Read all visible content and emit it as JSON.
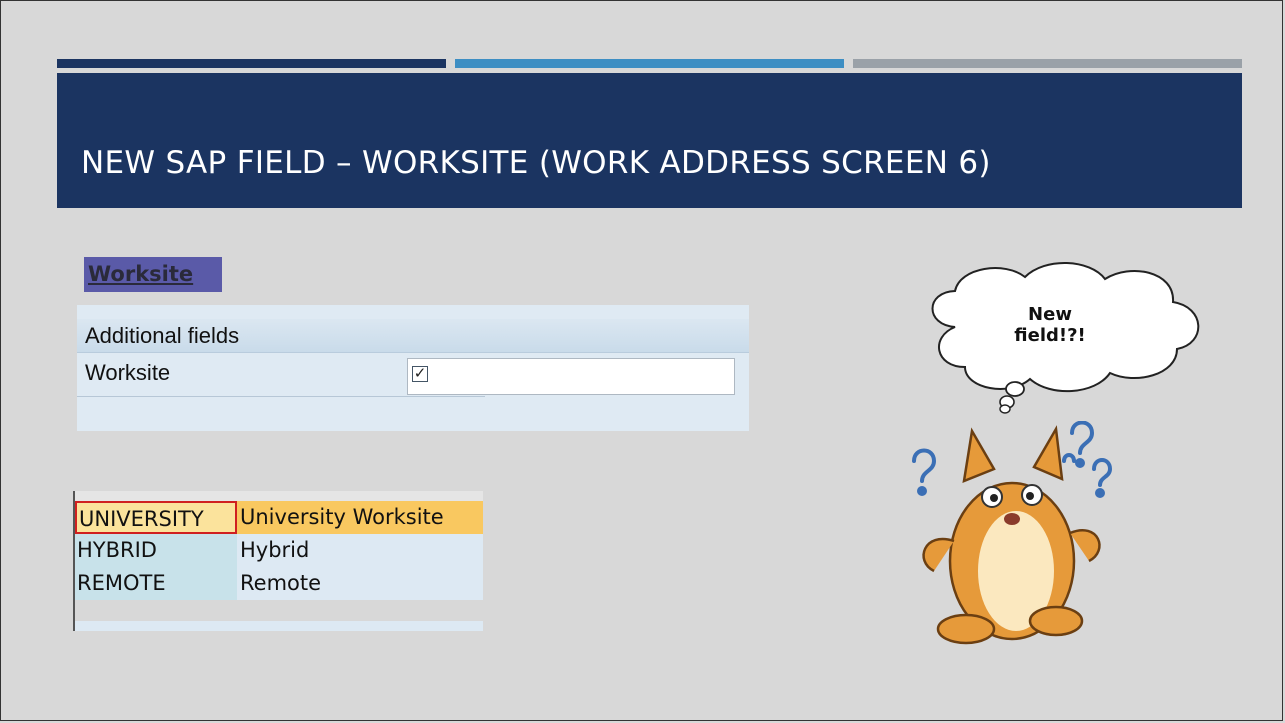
{
  "slide": {
    "title": "NEW SAP FIELD – WORKSITE (WORK ADDRESS SCREEN 6)",
    "section_label": "Worksite"
  },
  "sap_screen": {
    "header": "Additional fields",
    "field_label": "Worksite",
    "checkbox_checked": true
  },
  "value_table": {
    "rows": [
      {
        "code": "UNIVERSITY",
        "description": "University Worksite",
        "selected": true
      },
      {
        "code": "HYBRID",
        "description": "Hybrid",
        "selected": false
      },
      {
        "code": "REMOTE",
        "description": "Remote",
        "selected": false
      }
    ]
  },
  "callout": {
    "text": "New field!?!"
  },
  "colors": {
    "title_band": "#1b3461",
    "bar_mid": "#3d8ec3",
    "bar_right": "#9aa1a8",
    "selection": "#f9c860"
  },
  "icons": [
    "checkbox-icon",
    "thought-cloud",
    "confused-cat-illustration",
    "question-mark-icon"
  ]
}
